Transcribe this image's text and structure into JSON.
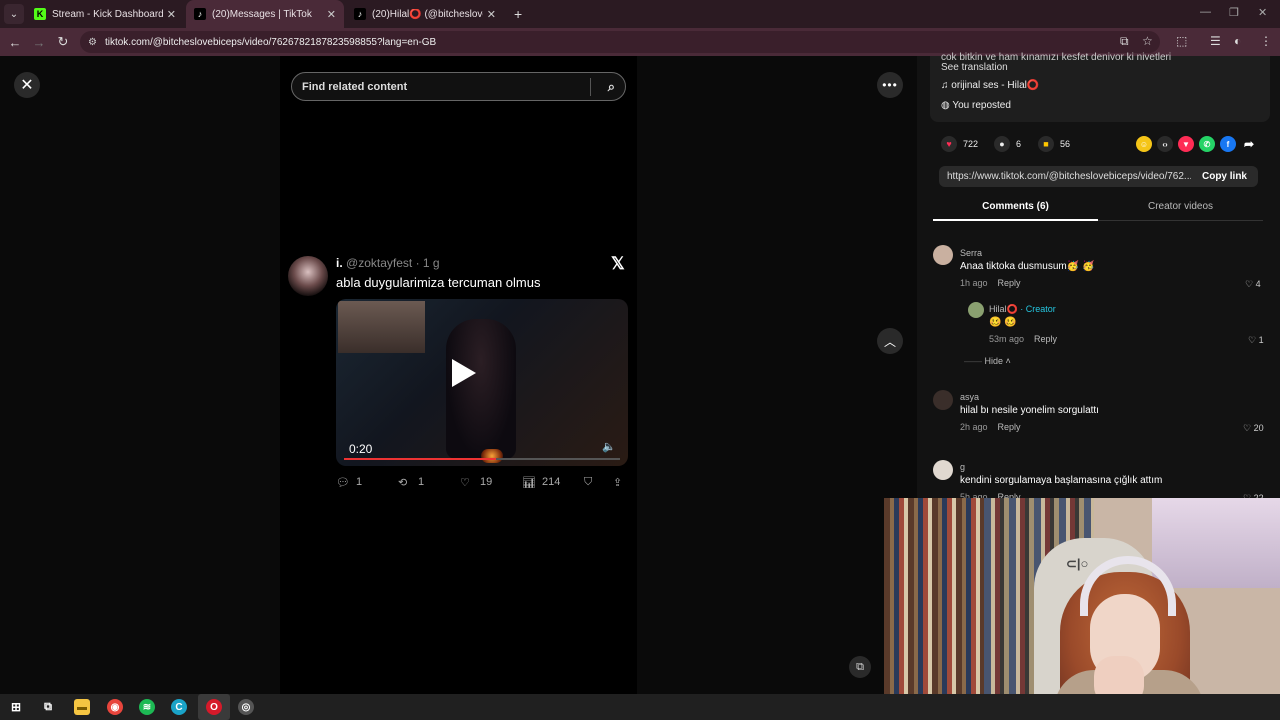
{
  "browser": {
    "tabs": [
      {
        "title": "Stream - Kick Dashboard",
        "favicon": "kick-icon",
        "active": false
      },
      {
        "title": "(20)Messages | TikTok",
        "favicon": "tiktok-icon",
        "active": true
      },
      {
        "title": "(20)Hilal⭕ (@bitcheslovebicep",
        "favicon": "tiktok-icon",
        "active": false
      }
    ],
    "new_tab": "+",
    "url": "tiktok.com/@bitcheslovebiceps/video/7626782187823598855?lang=en-GB"
  },
  "viewer": {
    "search_placeholder": "Find related content",
    "tweet": {
      "display_name": "i.",
      "handle": "@zoktayfest",
      "age": "· 1 g",
      "text": "abla duygularimiza tercuman olmus",
      "video_time": "0:20",
      "replies": "1",
      "retweets": "1",
      "likes": "19",
      "views": "214"
    }
  },
  "panel": {
    "description_cut": "çok bitkin ve ham kınamızı keşfet deniyor ki niyetleri",
    "see_translation": "See translation",
    "sound": "orijinal ses - Hilal⭕",
    "reposted": "You reposted",
    "likes": "722",
    "comments": "6",
    "saves": "56",
    "link": "https://www.tiktok.com/@bitcheslovebiceps/video/762...",
    "copy_link": "Copy link",
    "tab_comments": "Comments (6)",
    "tab_creator": "Creator videos",
    "comment_list": [
      {
        "user": "Serra",
        "text": "Anaa tiktoka dusmusum🥳 🥳",
        "time": "1h ago",
        "reply": "Reply",
        "likes": "4"
      },
      {
        "user": "Hilal⭕",
        "tag": "· Creator",
        "text": "🥴 🥴",
        "time": "53m ago",
        "reply": "Reply",
        "likes": "1"
      },
      {
        "user": "asya",
        "text": "hilal bı nesile yonelim sorgulattı",
        "time": "2h ago",
        "reply": "Reply",
        "likes": "20"
      },
      {
        "user": "g",
        "text": "kendini sorgulamaya başlamasına çığlık attım",
        "time": "5h ago",
        "reply": "Reply",
        "likes": "22"
      }
    ],
    "hide": "Hide"
  },
  "colors": {
    "tiktok_accent": "#fe2c55",
    "creator_tag": "#25c6e0",
    "browser_frame": "#4a2a38"
  }
}
